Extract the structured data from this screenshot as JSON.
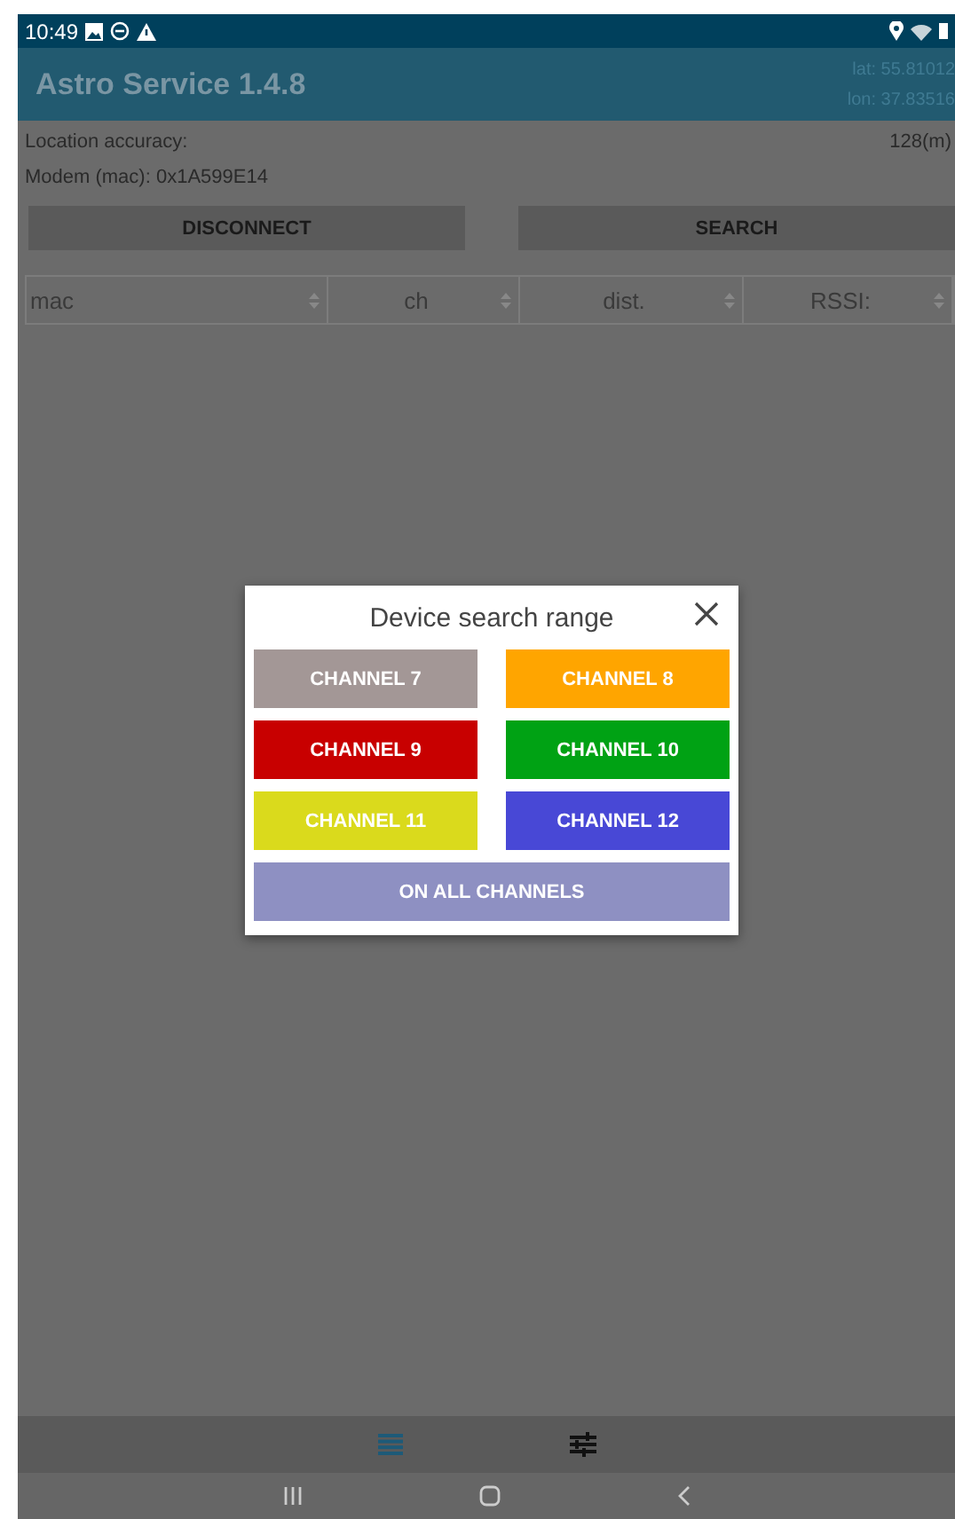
{
  "status_bar": {
    "time": "10:49"
  },
  "app_bar": {
    "title": "Astro Service 1.4.8",
    "lat": "lat: 55.81012",
    "lon": "lon: 37.83516"
  },
  "info": {
    "accuracy_label": "Location accuracy:",
    "accuracy_value": "128(m)",
    "modem": "Modem (mac): 0x1A599E14"
  },
  "buttons": [
    "DISCONNECT",
    "SEARCH"
  ],
  "columns": [
    "mac",
    "ch",
    "dist.",
    "RSSI:"
  ],
  "dialog": {
    "title": "Device search range",
    "channels": [
      {
        "label": "CHANNEL 7",
        "color": "#a39796"
      },
      {
        "label": "CHANNEL 8",
        "color": "#ffa500"
      },
      {
        "label": "CHANNEL 9",
        "color": "#c80000"
      },
      {
        "label": "CHANNEL 10",
        "color": "#00a214"
      },
      {
        "label": "CHANNEL 11",
        "color": "#dada1c"
      },
      {
        "label": "CHANNEL 12",
        "color": "#4848d6"
      }
    ],
    "all_button": {
      "label": "ON ALL CHANNELS",
      "color": "#8e90c2"
    }
  },
  "bottom_tabs": [
    {
      "kind": "list",
      "selected": true
    },
    {
      "kind": "sliders",
      "selected": false
    }
  ]
}
